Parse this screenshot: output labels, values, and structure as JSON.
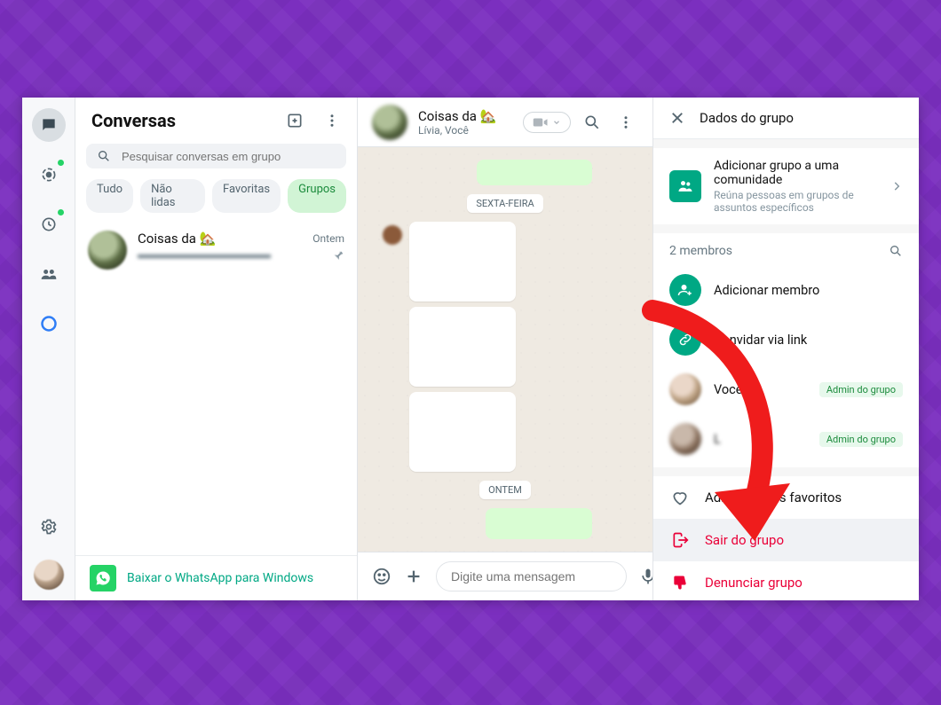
{
  "sidebar": {
    "title": "Conversas",
    "search_placeholder": "Pesquisar conversas em grupo",
    "filters": {
      "all": "Tudo",
      "unread": "Não lidas",
      "favorites": "Favoritas",
      "groups": "Grupos"
    },
    "download_label": "Baixar o WhatsApp para Windows"
  },
  "chat_item": {
    "name": "Coisas da 🏡",
    "time": "Ontem",
    "preview": "▬▬▬▬▬▬▬▬▬▬▬▬"
  },
  "chat_header": {
    "title": "Coisas da 🏡",
    "subtitle": "Lívia, Você"
  },
  "dates": {
    "friday": "SEXTA-FEIRA",
    "yesterday": "ONTEM"
  },
  "input": {
    "placeholder": "Digite uma mensagem"
  },
  "info": {
    "title": "Dados do grupo",
    "community_title": "Adicionar grupo a uma comunidade",
    "community_sub": "Reúna pessoas em grupos de assuntos específicos",
    "members_count": "2 membros",
    "add_member": "Adicionar membro",
    "invite_link": "Convidar via link",
    "you": "Você",
    "other": "L",
    "admin_badge": "Admin do grupo",
    "favorite": "Adicionar aos favoritos",
    "leave": "Sair do grupo",
    "report": "Denunciar grupo"
  }
}
